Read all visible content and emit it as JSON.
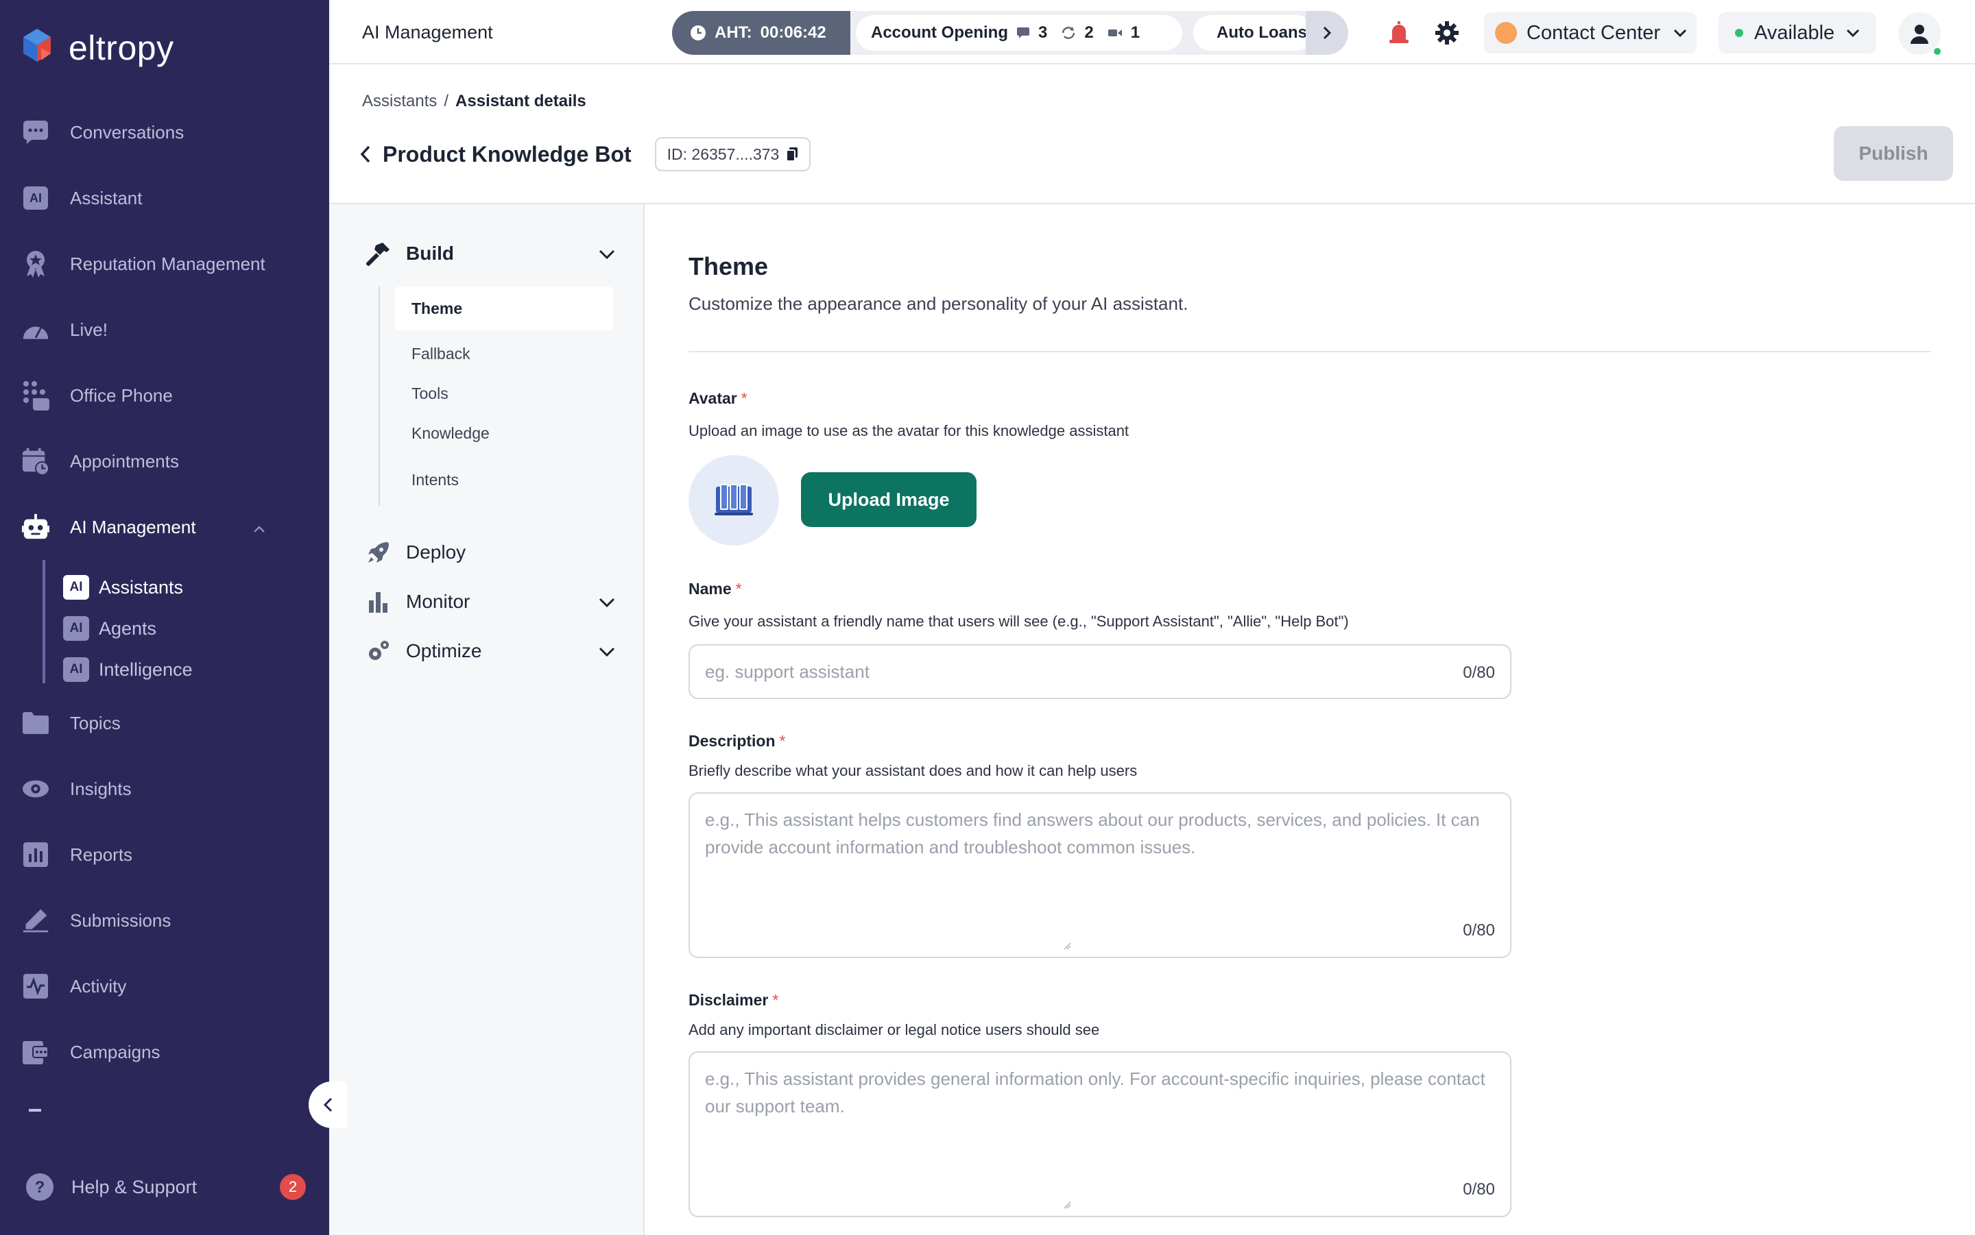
{
  "app": {
    "logo_text": "eltropy"
  },
  "sidebar": {
    "items": [
      {
        "label": "Conversations",
        "icon": "chat-icon"
      },
      {
        "label": "Assistant",
        "icon": "ai-icon"
      },
      {
        "label": "Reputation Management",
        "icon": "badge-icon"
      },
      {
        "label": "Live!",
        "icon": "speedometer-icon"
      },
      {
        "label": "Office Phone",
        "icon": "phone-keypad-icon"
      },
      {
        "label": "Appointments",
        "icon": "calendar-icon"
      },
      {
        "label": "AI Management",
        "icon": "robot-icon",
        "active": true
      }
    ],
    "ai_sub_items": [
      {
        "label": "Assistants",
        "active": true
      },
      {
        "label": "Agents"
      },
      {
        "label": "Intelligence"
      }
    ],
    "items_after": [
      {
        "label": "Topics",
        "icon": "folder-icon"
      },
      {
        "label": "Insights",
        "icon": "eye-icon"
      },
      {
        "label": "Reports",
        "icon": "bar-chart-icon"
      },
      {
        "label": "Submissions",
        "icon": "pen-icon"
      },
      {
        "label": "Activity",
        "icon": "activity-icon"
      },
      {
        "label": "Campaigns",
        "icon": "campaign-icon"
      }
    ],
    "ai_chip_text": "AI",
    "help_label": "Help & Support",
    "help_count": "2"
  },
  "topbar": {
    "title": "AI Management",
    "aht_label": "AHT:",
    "aht_value": "00:06:42",
    "queue_name": "Account Opening",
    "chat_count": "3",
    "call_count": "2",
    "video_count": "1",
    "next_queue": "Auto Loans",
    "center_select": "Contact Center",
    "status_select": "Available"
  },
  "header": {
    "breadcrumb_parent": "Assistants",
    "breadcrumb_sep": "/",
    "breadcrumb_current": "Assistant details",
    "title": "Product Knowledge Bot",
    "id_text": "ID: 26357....373",
    "publish_label": "Publish"
  },
  "panel": {
    "build_label": "Build",
    "build_items": [
      "Theme",
      "Fallback",
      "Tools",
      "Knowledge",
      "Intents"
    ],
    "deploy_label": "Deploy",
    "monitor_label": "Monitor",
    "optimize_label": "Optimize"
  },
  "content": {
    "title": "Theme",
    "subtitle": "Customize the appearance and personality of your AI assistant.",
    "avatar_label": "Avatar",
    "avatar_help": "Upload an image to use as the avatar for this knowledge assistant",
    "upload_label": "Upload Image",
    "name_label": "Name",
    "name_help": "Give your assistant a friendly name that users will see (e.g., \"Support Assistant\", \"Allie\", \"Help Bot\")",
    "name_placeholder": "eg. support assistant",
    "name_count": "0/80",
    "desc_label": "Description",
    "desc_help": "Briefly describe what your assistant does and how it can help users",
    "desc_placeholder": "e.g., This assistant helps customers find answers about our products, services, and policies. It can provide account information and troubleshoot common issues.",
    "desc_count": "0/80",
    "disc_label": "Disclaimer",
    "disc_help": "Add any important disclaimer or legal notice users should see",
    "disc_placeholder": "e.g., This assistant provides general information only. For account-specific inquiries, please contact our support team.",
    "disc_count": "0/80",
    "required_mark": "*"
  },
  "colors": {
    "sidebar_bg": "#2b2859",
    "primary_button": "#0d7461",
    "required": "#e24c4b",
    "badge": "#e24c4b"
  }
}
